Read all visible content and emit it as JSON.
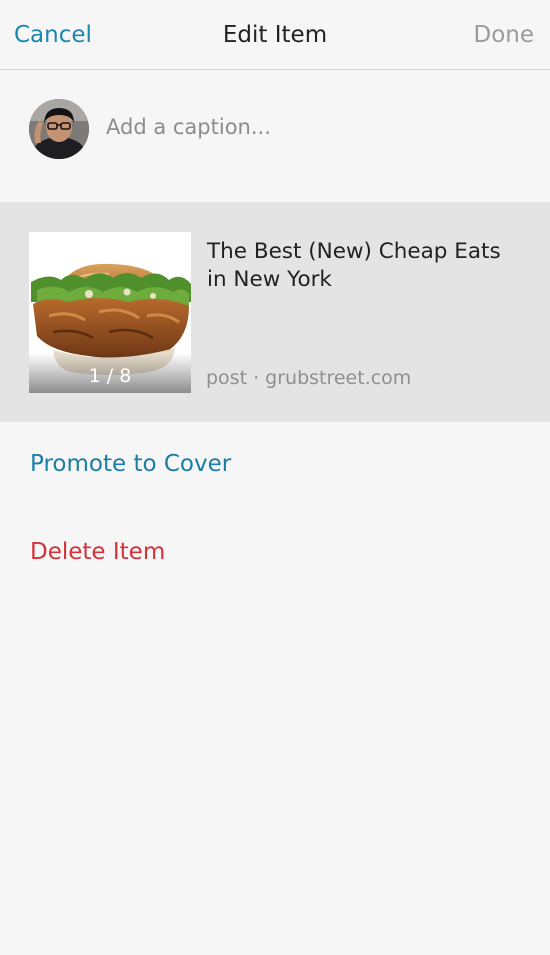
{
  "nav": {
    "cancel_label": "Cancel",
    "title": "Edit Item",
    "done_label": "Done"
  },
  "caption": {
    "placeholder": "Add a caption...",
    "value": ""
  },
  "item": {
    "title": "The Best (New) Cheap Eats in New York",
    "source": "post · grubstreet.com",
    "image_counter": "1 / 8"
  },
  "actions": {
    "promote_label": "Promote to Cover",
    "delete_label": "Delete Item"
  },
  "colors": {
    "accent": "#1d86b0",
    "danger": "#d4313a",
    "disabled": "#9a9a9a",
    "card_background": "#e4e4e4"
  }
}
